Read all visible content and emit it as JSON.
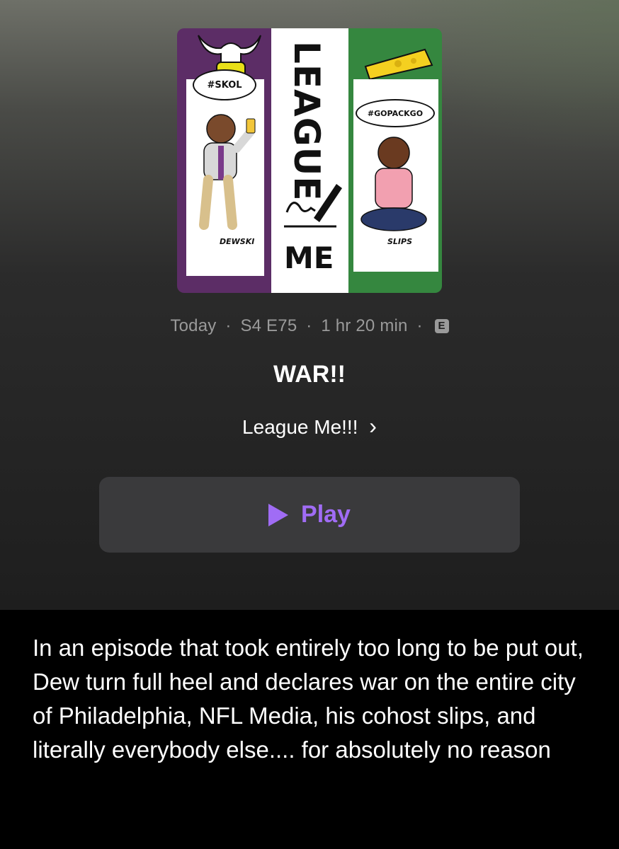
{
  "artwork": {
    "left_bubble": "#SKOL",
    "left_caption": "DEWSKI",
    "center_top": "LEAGUE",
    "center_bottom": "ME",
    "right_bubble": "#GOPACKGO",
    "right_caption": "SLIPS"
  },
  "episode": {
    "date": "Today",
    "season_episode": "S4 E75",
    "duration": "1 hr 20 min",
    "explicit_badge": "E",
    "separator": "·",
    "title": "WAR!!",
    "show_name": "League Me!!!",
    "show_chevron": "›"
  },
  "play_button": {
    "label": "Play",
    "icon": "play-icon"
  },
  "description": "In an episode that took entirely too long to be put out, Dew turn full heel and declares war on the entire city of Philadelphia, NFL Media, his cohost slips, and literally everybody else.... for absolutely no reason",
  "colors": {
    "accent": "#a06cf5",
    "button_bg": "#3a3a3c",
    "meta_text": "#9a9a9a",
    "art_purple": "#5c2d66",
    "art_green": "#35873f"
  }
}
